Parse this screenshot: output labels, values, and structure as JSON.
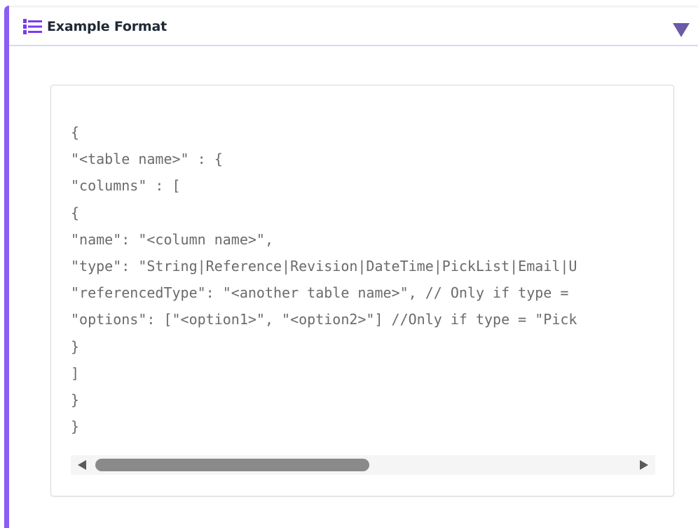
{
  "section": {
    "title": "Example Format",
    "icon": "numbered-list-icon",
    "toggle_icon": "triangle-down-icon",
    "accent_color": "#8b5cf6"
  },
  "code": {
    "lines": [
      "{",
      "\"<table name>\" : {",
      "\"columns\" : [",
      "{",
      "\"name\": \"<column name>\",",
      "\"type\": \"String|Reference|Revision|DateTime|PickList|Email|U",
      "\"referencedType\": \"<another table name>\", // Only if type = ",
      "\"options\": [\"<option1>\", \"<option2>\"] //Only if type = \"Pick",
      "}",
      "]",
      "}",
      "}"
    ]
  },
  "scrollbar": {
    "left_icon": "scroll-left-arrow-icon",
    "right_icon": "scroll-right-arrow-icon",
    "thumb_fraction": 0.47
  }
}
